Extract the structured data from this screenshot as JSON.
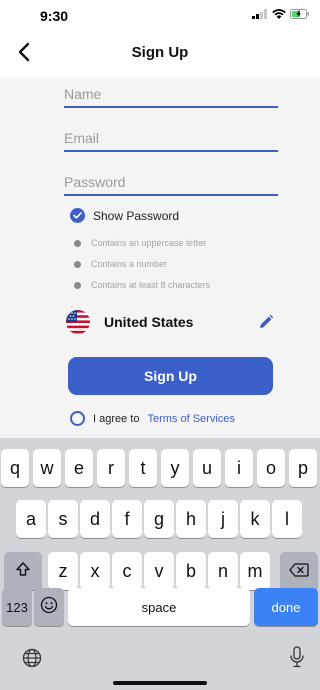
{
  "status_bar": {
    "time": "9:30",
    "icons": [
      "signal-icon",
      "wifi-icon",
      "battery-charging-icon"
    ]
  },
  "nav": {
    "back_icon": "chevron-left-icon",
    "title": "Sign Up"
  },
  "form": {
    "name": {
      "placeholder": "Name",
      "value": ""
    },
    "email": {
      "placeholder": "Email",
      "value": ""
    },
    "password": {
      "placeholder": "Password",
      "value": ""
    },
    "show_password": {
      "label": "Show Password",
      "checked": true
    },
    "password_rules": [
      "Contains an uppercase letter",
      "Contains a number",
      "Contains at least 8 characters"
    ],
    "country": {
      "name": "United States",
      "flag_icon": "us-flag-icon",
      "edit_icon": "pencil-icon"
    },
    "signup_label": "Sign Up",
    "agree": {
      "text": "I agree to",
      "link": "Terms of Services",
      "checked": false
    }
  },
  "keyboard": {
    "row1": [
      "q",
      "w",
      "e",
      "r",
      "t",
      "y",
      "u",
      "i",
      "o",
      "p"
    ],
    "row2": [
      "a",
      "s",
      "d",
      "f",
      "g",
      "h",
      "j",
      "k",
      "l"
    ],
    "row3": [
      "z",
      "x",
      "c",
      "v",
      "b",
      "n",
      "m"
    ],
    "shift_icon": "shift-icon",
    "backspace_icon": "backspace-icon",
    "numbers_label": "123",
    "emoji_icon": "emoji-icon",
    "space_label": "space",
    "done_label": "done",
    "globe_icon": "globe-icon",
    "mic_icon": "microphone-icon"
  },
  "colors": {
    "accent": "#3a5fc9",
    "keyboard_bg": "#d2d4da",
    "done_key": "#3b82f6"
  }
}
